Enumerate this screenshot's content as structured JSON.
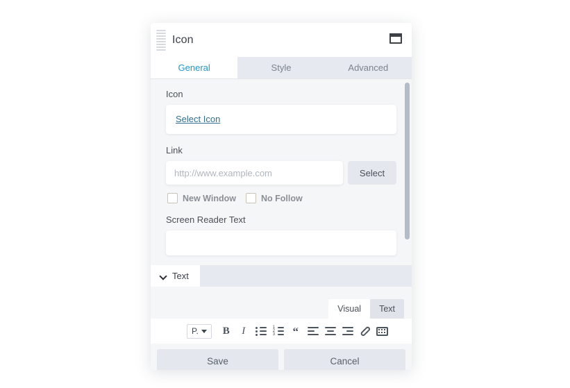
{
  "panel": {
    "title": "Icon",
    "drag_handle_name": "drag-handle",
    "window_icon": "window-icon",
    "tabs": [
      {
        "label": "General",
        "active": true
      },
      {
        "label": "Style",
        "active": false
      },
      {
        "label": "Advanced",
        "active": false
      }
    ],
    "accent_color": "#2196c9"
  },
  "general": {
    "icon_field": {
      "label": "Icon",
      "select_link": "Select Icon"
    },
    "link_field": {
      "label": "Link",
      "placeholder": "http://www.example.com",
      "value": "",
      "select_button": "Select"
    },
    "options": [
      {
        "label": "New Window",
        "checked": false
      },
      {
        "label": "No Follow",
        "checked": false
      }
    ],
    "screen_reader_field": {
      "label": "Screen Reader Text",
      "value": ""
    }
  },
  "text_section": {
    "label": "Text",
    "chevron": "chevron-down-icon",
    "editor_tabs": [
      {
        "label": "Visual",
        "active": true
      },
      {
        "label": "Text",
        "active": false
      }
    ],
    "toolbar": {
      "paragraph_select": "P.",
      "buttons": [
        {
          "name": "bold-icon",
          "glyph": "B"
        },
        {
          "name": "italic-icon",
          "glyph": "I"
        },
        {
          "name": "bulleted-list-icon",
          "glyph": ""
        },
        {
          "name": "numbered-list-icon",
          "glyph": ""
        },
        {
          "name": "blockquote-icon",
          "glyph": "“"
        },
        {
          "name": "align-left-icon",
          "glyph": ""
        },
        {
          "name": "align-center-icon",
          "glyph": ""
        },
        {
          "name": "align-right-icon",
          "glyph": ""
        },
        {
          "name": "insert-link-icon",
          "glyph": ""
        },
        {
          "name": "toolbar-toggle-icon",
          "glyph": ""
        }
      ]
    }
  },
  "footer": {
    "save_label": "Save",
    "cancel_label": "Cancel"
  }
}
